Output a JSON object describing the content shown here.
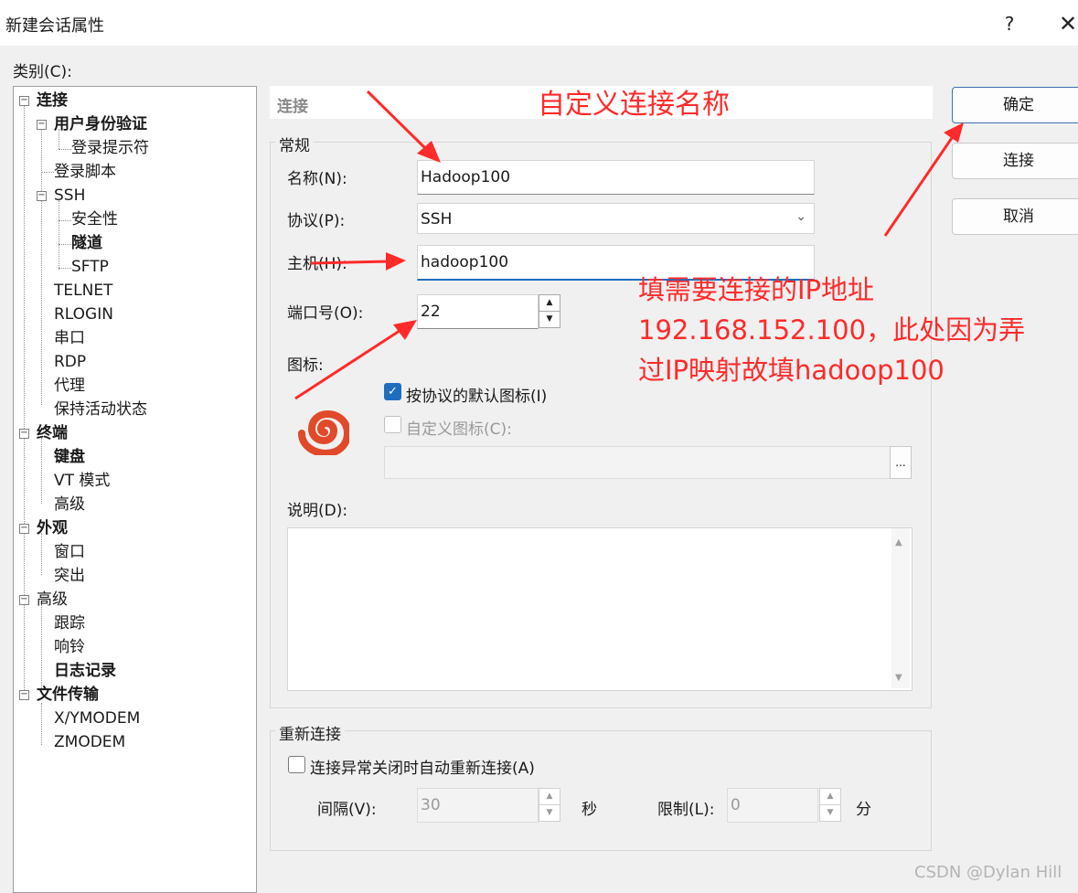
{
  "window": {
    "title": "新建会话属性",
    "help": "?",
    "close": "✕"
  },
  "category": {
    "label": "类别(C):",
    "items": [
      {
        "label": "连接",
        "bold": true
      },
      {
        "label": "用户身份验证",
        "bold": true
      },
      {
        "label": "登录提示符",
        "bold": false
      },
      {
        "label": "登录脚本",
        "bold": false
      },
      {
        "label": "SSH",
        "bold": false
      },
      {
        "label": "安全性",
        "bold": false
      },
      {
        "label": "隧道",
        "bold": true
      },
      {
        "label": "SFTP",
        "bold": false
      },
      {
        "label": "TELNET",
        "bold": false
      },
      {
        "label": "RLOGIN",
        "bold": false
      },
      {
        "label": "串口",
        "bold": false
      },
      {
        "label": "RDP",
        "bold": false
      },
      {
        "label": "代理",
        "bold": false
      },
      {
        "label": "保持活动状态",
        "bold": false
      },
      {
        "label": "终端",
        "bold": true
      },
      {
        "label": "键盘",
        "bold": true
      },
      {
        "label": "VT 模式",
        "bold": false
      },
      {
        "label": "高级",
        "bold": false
      },
      {
        "label": "外观",
        "bold": true
      },
      {
        "label": "窗口",
        "bold": false
      },
      {
        "label": "突出",
        "bold": false
      },
      {
        "label": "高级",
        "bold": false
      },
      {
        "label": "跟踪",
        "bold": false
      },
      {
        "label": "响铃",
        "bold": false
      },
      {
        "label": "日志记录",
        "bold": true
      },
      {
        "label": "文件传输",
        "bold": true
      },
      {
        "label": "X/YMODEM",
        "bold": false
      },
      {
        "label": "ZMODEM",
        "bold": false
      }
    ]
  },
  "section_header": "连接",
  "general": {
    "group_title": "常规",
    "name_label": "名称(N):",
    "name_value": "Hadoop100",
    "protocol_label": "协议(P):",
    "protocol_value": "SSH",
    "host_label": "主机(H):",
    "host_value": "hadoop100",
    "port_label": "端口号(O):",
    "port_value": "22",
    "icon_label": "图标:",
    "default_icon_check": "按协议的默认图标(I)",
    "default_icon_checked": true,
    "custom_icon_check": "自定义图标(C):",
    "custom_icon_checked": false,
    "browse_label": "...",
    "desc_label": "说明(D):",
    "desc_value": ""
  },
  "reconnect": {
    "group_title": "重新连接",
    "auto_label": "连接异常关闭时自动重新连接(A)",
    "auto_checked": false,
    "interval_label": "间隔(V):",
    "interval_value": "30",
    "interval_unit": "秒",
    "limit_label": "限制(L):",
    "limit_value": "0",
    "limit_unit": "分"
  },
  "buttons": {
    "ok": "确定",
    "connect": "连接",
    "cancel": "取消"
  },
  "annotations": {
    "name_hint": "自定义连接名称",
    "ip_hint_1": "填需要连接的IP地址",
    "ip_hint_2": "192.168.152.100，此处因为弄",
    "ip_hint_3": "过IP映射故填hadoop100"
  },
  "watermark": "CSDN @Dylan Hill",
  "colors": {
    "annotation": "#ff2a2a",
    "accent": "#1f6dbf",
    "icon": "#e04a2a"
  }
}
